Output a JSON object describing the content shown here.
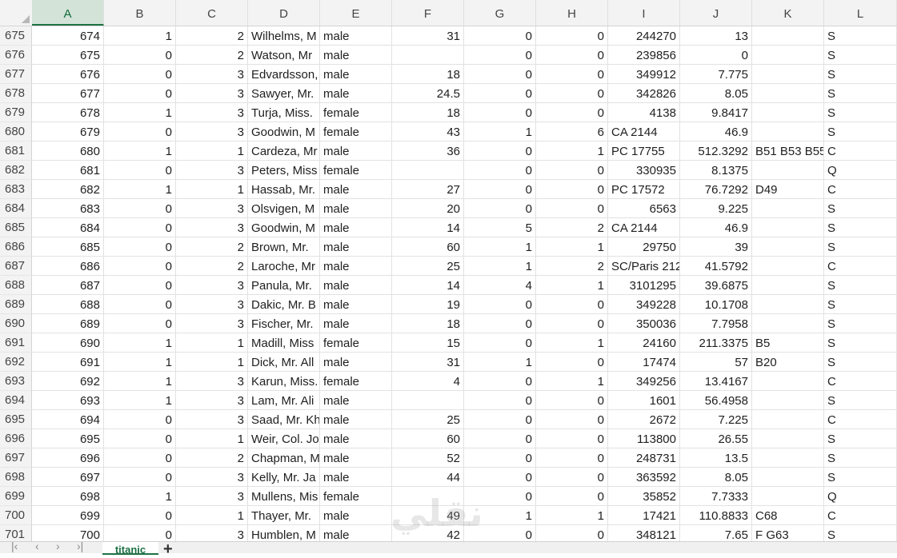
{
  "sheet": {
    "columns": [
      "A",
      "B",
      "C",
      "D",
      "E",
      "F",
      "G",
      "H",
      "I",
      "J",
      "K",
      "L"
    ],
    "selected_column": "A",
    "rows": [
      {
        "n": "675",
        "cells": [
          "674",
          "1",
          "2",
          "Wilhelms, M",
          "male",
          "31",
          "0",
          "0",
          "244270",
          "13",
          "",
          "S"
        ]
      },
      {
        "n": "676",
        "cells": [
          "675",
          "0",
          "2",
          "Watson, Mr",
          "male",
          "",
          "0",
          "0",
          "239856",
          "0",
          "",
          "S"
        ]
      },
      {
        "n": "677",
        "cells": [
          "676",
          "0",
          "3",
          "Edvardsson,",
          "male",
          "18",
          "0",
          "0",
          "349912",
          "7.775",
          "",
          "S"
        ]
      },
      {
        "n": "678",
        "cells": [
          "677",
          "0",
          "3",
          "Sawyer, Mr.",
          "male",
          "24.5",
          "0",
          "0",
          "342826",
          "8.05",
          "",
          "S"
        ]
      },
      {
        "n": "679",
        "cells": [
          "678",
          "1",
          "3",
          "Turja, Miss.",
          "female",
          "18",
          "0",
          "0",
          "4138",
          "9.8417",
          "",
          "S"
        ]
      },
      {
        "n": "680",
        "cells": [
          "679",
          "0",
          "3",
          "Goodwin, M",
          "female",
          "43",
          "1",
          "6",
          "CA 2144",
          "46.9",
          "",
          "S"
        ]
      },
      {
        "n": "681",
        "cells": [
          "680",
          "1",
          "1",
          "Cardeza, Mr",
          "male",
          "36",
          "0",
          "1",
          "PC 17755",
          "512.3292",
          "B51 B53 B55",
          "C"
        ]
      },
      {
        "n": "682",
        "cells": [
          "681",
          "0",
          "3",
          "Peters, Miss",
          "female",
          "",
          "0",
          "0",
          "330935",
          "8.1375",
          "",
          "Q"
        ]
      },
      {
        "n": "683",
        "cells": [
          "682",
          "1",
          "1",
          "Hassab, Mr.",
          "male",
          "27",
          "0",
          "0",
          "PC 17572",
          "76.7292",
          "D49",
          "C"
        ]
      },
      {
        "n": "684",
        "cells": [
          "683",
          "0",
          "3",
          "Olsvigen, M",
          "male",
          "20",
          "0",
          "0",
          "6563",
          "9.225",
          "",
          "S"
        ]
      },
      {
        "n": "685",
        "cells": [
          "684",
          "0",
          "3",
          "Goodwin, M",
          "male",
          "14",
          "5",
          "2",
          "CA 2144",
          "46.9",
          "",
          "S"
        ]
      },
      {
        "n": "686",
        "cells": [
          "685",
          "0",
          "2",
          "Brown, Mr.",
          "male",
          "60",
          "1",
          "1",
          "29750",
          "39",
          "",
          "S"
        ]
      },
      {
        "n": "687",
        "cells": [
          "686",
          "0",
          "2",
          "Laroche, Mr",
          "male",
          "25",
          "1",
          "2",
          "SC/Paris 212",
          "41.5792",
          "",
          "C"
        ]
      },
      {
        "n": "688",
        "cells": [
          "687",
          "0",
          "3",
          "Panula, Mr.",
          "male",
          "14",
          "4",
          "1",
          "3101295",
          "39.6875",
          "",
          "S"
        ]
      },
      {
        "n": "689",
        "cells": [
          "688",
          "0",
          "3",
          "Dakic, Mr. B",
          "male",
          "19",
          "0",
          "0",
          "349228",
          "10.1708",
          "",
          "S"
        ]
      },
      {
        "n": "690",
        "cells": [
          "689",
          "0",
          "3",
          "Fischer, Mr.",
          "male",
          "18",
          "0",
          "0",
          "350036",
          "7.7958",
          "",
          "S"
        ]
      },
      {
        "n": "691",
        "cells": [
          "690",
          "1",
          "1",
          "Madill, Miss",
          "female",
          "15",
          "0",
          "1",
          "24160",
          "211.3375",
          "B5",
          "S"
        ]
      },
      {
        "n": "692",
        "cells": [
          "691",
          "1",
          "1",
          "Dick, Mr. All",
          "male",
          "31",
          "1",
          "0",
          "17474",
          "57",
          "B20",
          "S"
        ]
      },
      {
        "n": "693",
        "cells": [
          "692",
          "1",
          "3",
          "Karun, Miss.",
          "female",
          "4",
          "0",
          "1",
          "349256",
          "13.4167",
          "",
          "C"
        ]
      },
      {
        "n": "694",
        "cells": [
          "693",
          "1",
          "3",
          "Lam, Mr. Ali",
          "male",
          "",
          "0",
          "0",
          "1601",
          "56.4958",
          "",
          "S"
        ]
      },
      {
        "n": "695",
        "cells": [
          "694",
          "0",
          "3",
          "Saad, Mr. Kh",
          "male",
          "25",
          "0",
          "0",
          "2672",
          "7.225",
          "",
          "C"
        ]
      },
      {
        "n": "696",
        "cells": [
          "695",
          "0",
          "1",
          "Weir, Col. Jo",
          "male",
          "60",
          "0",
          "0",
          "113800",
          "26.55",
          "",
          "S"
        ]
      },
      {
        "n": "697",
        "cells": [
          "696",
          "0",
          "2",
          "Chapman, M",
          "male",
          "52",
          "0",
          "0",
          "248731",
          "13.5",
          "",
          "S"
        ]
      },
      {
        "n": "698",
        "cells": [
          "697",
          "0",
          "3",
          "Kelly, Mr. Ja",
          "male",
          "44",
          "0",
          "0",
          "363592",
          "8.05",
          "",
          "S"
        ]
      },
      {
        "n": "699",
        "cells": [
          "698",
          "1",
          "3",
          "Mullens, Mis",
          "female",
          "",
          "0",
          "0",
          "35852",
          "7.7333",
          "",
          "Q"
        ]
      },
      {
        "n": "700",
        "cells": [
          "699",
          "0",
          "1",
          "Thayer, Mr.",
          "male",
          "49",
          "1",
          "1",
          "17421",
          "110.8833",
          "C68",
          "C"
        ]
      },
      {
        "n": "701",
        "cells": [
          "700",
          "0",
          "3",
          "Humblen, M",
          "male",
          "42",
          "0",
          "0",
          "348121",
          "7.65",
          "F G63",
          "S"
        ]
      }
    ]
  },
  "tabs": {
    "nav_icons": [
      "first-sheet-icon",
      "prev-sheet-icon",
      "next-sheet-icon",
      "last-sheet-icon"
    ],
    "active_tab": "titanic",
    "add_label": "+"
  },
  "watermark": {
    "text": "نقلي"
  },
  "colors": {
    "accent": "#1e7145",
    "header_bg": "#f3f3f3",
    "selected_header_bg": "#d3e3d8"
  }
}
